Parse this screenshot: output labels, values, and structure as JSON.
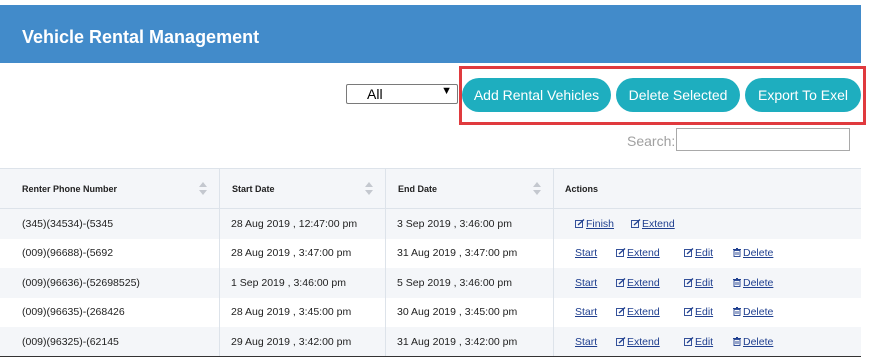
{
  "header": {
    "title": "Vehicle Rental Management"
  },
  "toolbar": {
    "filter_value": "All",
    "add_label": "Add Rental Vehicles",
    "delete_label": "Delete Selected",
    "export_label": "Export To Exel",
    "search_label": "Search:",
    "search_value": ""
  },
  "colors": {
    "header": "#428bca",
    "button": "#1eaebf",
    "highlight": "#e03a3e",
    "link": "#1f3f8f"
  },
  "table": {
    "columns": [
      "Renter Phone Number",
      "Start Date",
      "End Date",
      "Actions"
    ],
    "rows": [
      {
        "phone": "(345)(34534)-(5345",
        "start": "28 Aug 2019 , 12:47:00 pm",
        "end": "3 Sep 2019 , 3:46:00 pm",
        "actions": [
          "Finish",
          "Extend"
        ]
      },
      {
        "phone": "(009)(96688)-(5692",
        "start": "28 Aug 2019 , 3:47:00 pm",
        "end": "31 Aug 2019 , 3:47:00 pm",
        "actions": [
          "Start",
          "Extend",
          "Edit",
          "Delete"
        ]
      },
      {
        "phone": "(009)(96636)-(52698525)",
        "start": "1 Sep 2019 , 3:46:00 pm",
        "end": "5 Sep 2019 , 3:46:00 pm",
        "actions": [
          "Start",
          "Extend",
          "Edit",
          "Delete"
        ]
      },
      {
        "phone": "(009)(96635)-(268426",
        "start": "28 Aug 2019 , 3:45:00 pm",
        "end": "30 Aug 2019 , 3:45:00 pm",
        "actions": [
          "Start",
          "Extend",
          "Edit",
          "Delete"
        ]
      },
      {
        "phone": "(009)(96325)-(62145",
        "start": "29 Aug 2019 , 3:42:00 pm",
        "end": "31 Aug 2019 , 3:42:00 pm",
        "actions": [
          "Start",
          "Extend",
          "Edit",
          "Delete"
        ]
      }
    ]
  }
}
